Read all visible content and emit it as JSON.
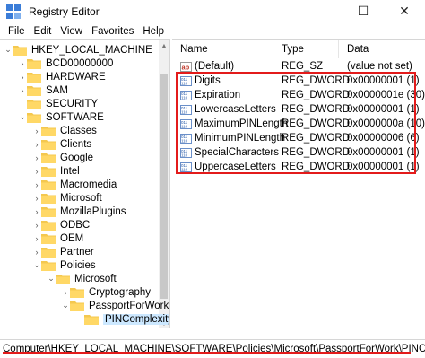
{
  "window": {
    "title": "Registry Editor",
    "minimize": "—",
    "maximize": "☐",
    "close": "✕"
  },
  "menu": [
    "File",
    "Edit",
    "View",
    "Favorites",
    "Help"
  ],
  "tree": [
    {
      "label": "HKEY_LOCAL_MACHINE",
      "level": 0,
      "expander": "down"
    },
    {
      "label": "BCD00000000",
      "level": 1,
      "expander": "right"
    },
    {
      "label": "HARDWARE",
      "level": 1,
      "expander": "right"
    },
    {
      "label": "SAM",
      "level": 1,
      "expander": "right"
    },
    {
      "label": "SECURITY",
      "level": 1,
      "expander": "none"
    },
    {
      "label": "SOFTWARE",
      "level": 1,
      "expander": "down"
    },
    {
      "label": "Classes",
      "level": 2,
      "expander": "right"
    },
    {
      "label": "Clients",
      "level": 2,
      "expander": "right"
    },
    {
      "label": "Google",
      "level": 2,
      "expander": "right"
    },
    {
      "label": "Intel",
      "level": 2,
      "expander": "right"
    },
    {
      "label": "Macromedia",
      "level": 2,
      "expander": "right"
    },
    {
      "label": "Microsoft",
      "level": 2,
      "expander": "right"
    },
    {
      "label": "MozillaPlugins",
      "level": 2,
      "expander": "right"
    },
    {
      "label": "ODBC",
      "level": 2,
      "expander": "right"
    },
    {
      "label": "OEM",
      "level": 2,
      "expander": "right"
    },
    {
      "label": "Partner",
      "level": 2,
      "expander": "right"
    },
    {
      "label": "Policies",
      "level": 2,
      "expander": "down"
    },
    {
      "label": "Microsoft",
      "level": 3,
      "expander": "down"
    },
    {
      "label": "Cryptography",
      "level": 4,
      "expander": "right"
    },
    {
      "label": "PassportForWork",
      "level": 4,
      "expander": "down"
    },
    {
      "label": "PINComplexity",
      "level": 5,
      "expander": "none",
      "selected": true
    }
  ],
  "columns": {
    "name": "Name",
    "type": "Type",
    "data": "Data"
  },
  "values": [
    {
      "name": "(Default)",
      "type": "REG_SZ",
      "data": "(value not set)",
      "kind": "string"
    },
    {
      "name": "Digits",
      "type": "REG_DWORD",
      "data": "0x00000001 (1)",
      "kind": "binary"
    },
    {
      "name": "Expiration",
      "type": "REG_DWORD",
      "data": "0x0000001e (30)",
      "kind": "binary"
    },
    {
      "name": "LowercaseLetters",
      "type": "REG_DWORD",
      "data": "0x00000001 (1)",
      "kind": "binary"
    },
    {
      "name": "MaximumPINLength",
      "type": "REG_DWORD",
      "data": "0x0000000a (10)",
      "kind": "binary"
    },
    {
      "name": "MinimumPINLength",
      "type": "REG_DWORD",
      "data": "0x00000006 (6)",
      "kind": "binary"
    },
    {
      "name": "SpecialCharacters",
      "type": "REG_DWORD",
      "data": "0x00000001 (1)",
      "kind": "binary"
    },
    {
      "name": "UppercaseLetters",
      "type": "REG_DWORD",
      "data": "0x00000001 (1)",
      "kind": "binary"
    }
  ],
  "status": {
    "path": "Computer\\HKEY_LOCAL_MACHINE\\SOFTWARE\\Policies\\Microsoft\\PassportForWork\\PINComplexity"
  },
  "colors": {
    "accent_highlight": "#e31b1b",
    "folder": "#f4c84f",
    "selection": "#cce8ff"
  },
  "icons": {
    "app": "registry-editor-icon",
    "folder": "folder-icon",
    "string_value": "string-value-icon",
    "dword_value": "dword-value-icon"
  }
}
